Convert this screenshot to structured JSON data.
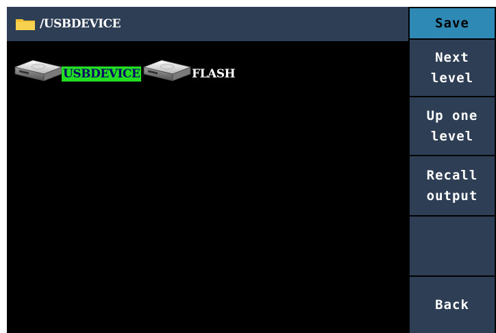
{
  "path_bar": {
    "icon": "folder-icon",
    "path": "/USBDEVICE"
  },
  "devices": [
    {
      "icon": "drive-icon",
      "label": "USBDEVICE",
      "selected": true
    },
    {
      "icon": "drive-icon",
      "label": "FLASH",
      "selected": false
    }
  ],
  "menu": {
    "title": "Save",
    "buttons": [
      {
        "line1": "Next",
        "line2": "level"
      },
      {
        "line1": "Up one",
        "line2": "level"
      },
      {
        "line1": "Recall",
        "line2": "output"
      },
      {
        "line1": "",
        "line2": ""
      },
      {
        "line1": "Back",
        "line2": ""
      }
    ]
  },
  "colors": {
    "background": "#000000",
    "panel": "#2e3e55",
    "menu_title": "#2e8ab5",
    "selection": "#22dd22",
    "selection_text": "#0a0a66",
    "folder": "#f2c230"
  }
}
